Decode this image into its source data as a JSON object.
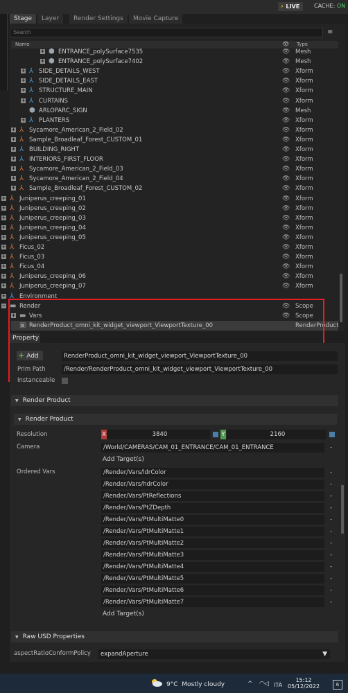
{
  "topbar": {
    "live": "LIVE",
    "cache_label": "CACHE:",
    "cache_state": "ON"
  },
  "tabs": [
    {
      "label": "Stage"
    },
    {
      "label": "Layer"
    },
    {
      "label": "Render Settings"
    },
    {
      "label": "Movie Capture"
    }
  ],
  "stage": {
    "search_placeholder": "Search",
    "col_name": "Name",
    "col_type": "Type",
    "rows": [
      {
        "label": "ENTRANCE_polySurface7535",
        "type": "Mesh"
      },
      {
        "label": "ENTRANCE_polySurface7402",
        "type": "Mesh"
      },
      {
        "label": "SIDE_DETAILS_WEST",
        "type": "Xform"
      },
      {
        "label": "SIDE_DETAILS_EAST",
        "type": "Xform"
      },
      {
        "label": "STRUCTURE_MAIN",
        "type": "Xform"
      },
      {
        "label": "CURTAINS",
        "type": "Xform"
      },
      {
        "label": "ARLOPARC_SIGN",
        "type": "Mesh"
      },
      {
        "label": "PLANTERS",
        "type": "Xform"
      },
      {
        "label": "Sycamore_American_2_Field_02",
        "type": "Xform"
      },
      {
        "label": "Sample_Broadleaf_Forest_CUSTOM_01",
        "type": "Xform"
      },
      {
        "label": "BUILDING_RIGHT",
        "type": "Xform"
      },
      {
        "label": "INTERIORS_FIRST_FLOOR",
        "type": "Xform"
      },
      {
        "label": "Sycamore_American_2_Field_03",
        "type": "Xform"
      },
      {
        "label": "Sycamore_American_2_Field_04",
        "type": "Xform"
      },
      {
        "label": "Sample_Broadleaf_Forest_CUSTOM_02",
        "type": "Xform"
      },
      {
        "label": "Juniperus_creeping_01",
        "type": "Xform"
      },
      {
        "label": "Juniperus_creeping_02",
        "type": "Xform"
      },
      {
        "label": "Juniperus_creeping_03",
        "type": "Xform"
      },
      {
        "label": "Juniperus_creeping_04",
        "type": "Xform"
      },
      {
        "label": "Juniperus_creeping_05",
        "type": "Xform"
      },
      {
        "label": "Ficus_02",
        "type": "Xform"
      },
      {
        "label": "Ficus_03",
        "type": "Xform"
      },
      {
        "label": "Ficus_04",
        "type": "Xform"
      },
      {
        "label": "Juniperus_creeping_06",
        "type": "Xform"
      },
      {
        "label": "Juniperus_creeping_07",
        "type": "Xform"
      },
      {
        "label": "Environment",
        "type": ""
      },
      {
        "label": "Render",
        "type": "Scope"
      },
      {
        "label": "Vars",
        "type": "Scope"
      },
      {
        "label": "RenderProduct_omni_kit_widget_viewport_ViewportTexture_00",
        "type": "RenderProduct"
      }
    ]
  },
  "property": {
    "tab_label": "Property",
    "add_label": "Add",
    "name_value": "RenderProduct_omni_kit_widget_viewport_ViewportTexture_00",
    "prim_path_label": "Prim Path",
    "prim_path_value": "/Render/RenderProduct_omni_kit_widget_viewport_ViewportTexture_00",
    "instanceable_label": "Instanceable",
    "section_outer": "Render Product",
    "section_inner": "Render Product",
    "resolution_label": "Resolution",
    "res_x_tag": "X",
    "res_x": "3840",
    "res_y_tag": "Y",
    "res_y": "2160",
    "camera_label": "Camera",
    "camera_value": "/World/CAMERAS/CAM_01_ENTRANCE/CAM_01_ENTRANCE",
    "add_targets": "Add Target(s)",
    "ordered_vars_label": "Ordered Vars",
    "ordered_vars": [
      "/Render/Vars/ldrColor",
      "/Render/Vars/hdrColor",
      "/Render/Vars/PtReflections",
      "/Render/Vars/PtZDepth",
      "/Render/Vars/PtMultiMatte0",
      "/Render/Vars/PtMultiMatte1",
      "/Render/Vars/PtMultiMatte2",
      "/Render/Vars/PtMultiMatte3",
      "/Render/Vars/PtMultiMatte4",
      "/Render/Vars/PtMultiMatte5",
      "/Render/Vars/PtMultiMatte6",
      "/Render/Vars/PtMultiMatte7"
    ],
    "dash": "-",
    "add_targets_2": "Add Target(s)",
    "raw_section": "Raw USD Properties",
    "aspect_label": "aspectRatioConformPolicy",
    "aspect_value": "expandAperture"
  },
  "taskbar": {
    "temp": "9°C",
    "weather": "Mostly cloudy",
    "lang": "ITA",
    "time": "15:12",
    "date": "05/12/2022",
    "notif_count": "6"
  },
  "colors": {
    "accent_red": "#e31e24",
    "live_bolt": "#f1c40f",
    "cache_on": "#4fd16b"
  }
}
